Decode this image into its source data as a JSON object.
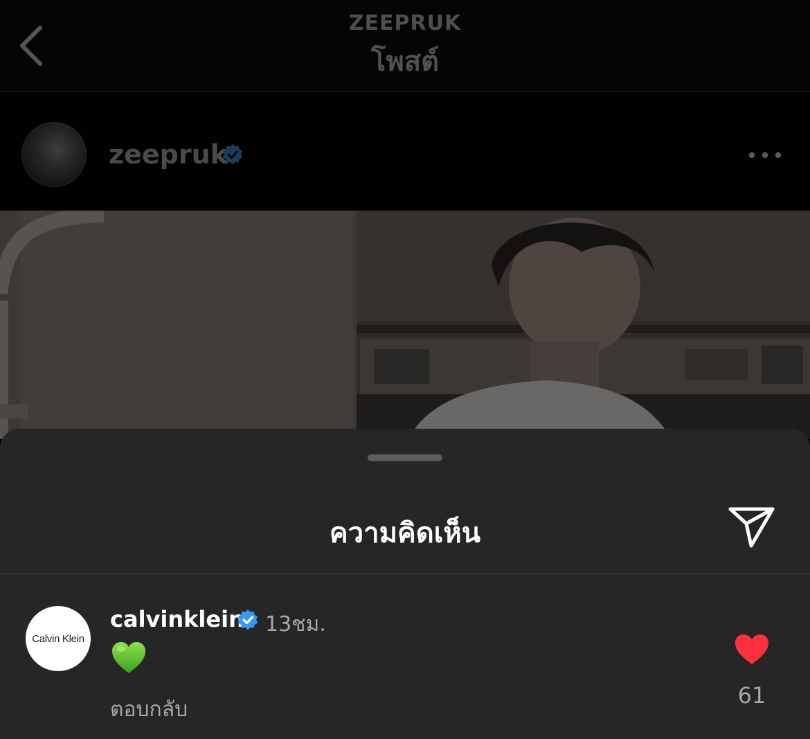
{
  "header": {
    "username": "ZEEPRUK",
    "title": "โพสต์",
    "back_icon": "chevron-left-icon"
  },
  "post": {
    "author": "zeepruk",
    "verified": true,
    "more_icon": "more-horizontal-icon"
  },
  "comments_sheet": {
    "title": "ความคิดเห็น",
    "share_icon": "paper-plane-icon",
    "comments": [
      {
        "avatar_text": "Calvin Klein",
        "username": "calvinklein",
        "verified": true,
        "time": "13ชม.",
        "text": "💚",
        "reply_label": "ตอบกลับ",
        "like_count": "61",
        "liked": true
      }
    ]
  },
  "colors": {
    "background": "#000000",
    "sheet": "#262626",
    "verified": "#3897f0",
    "like": "#ff3040",
    "secondary_text": "#a8a8a8"
  }
}
